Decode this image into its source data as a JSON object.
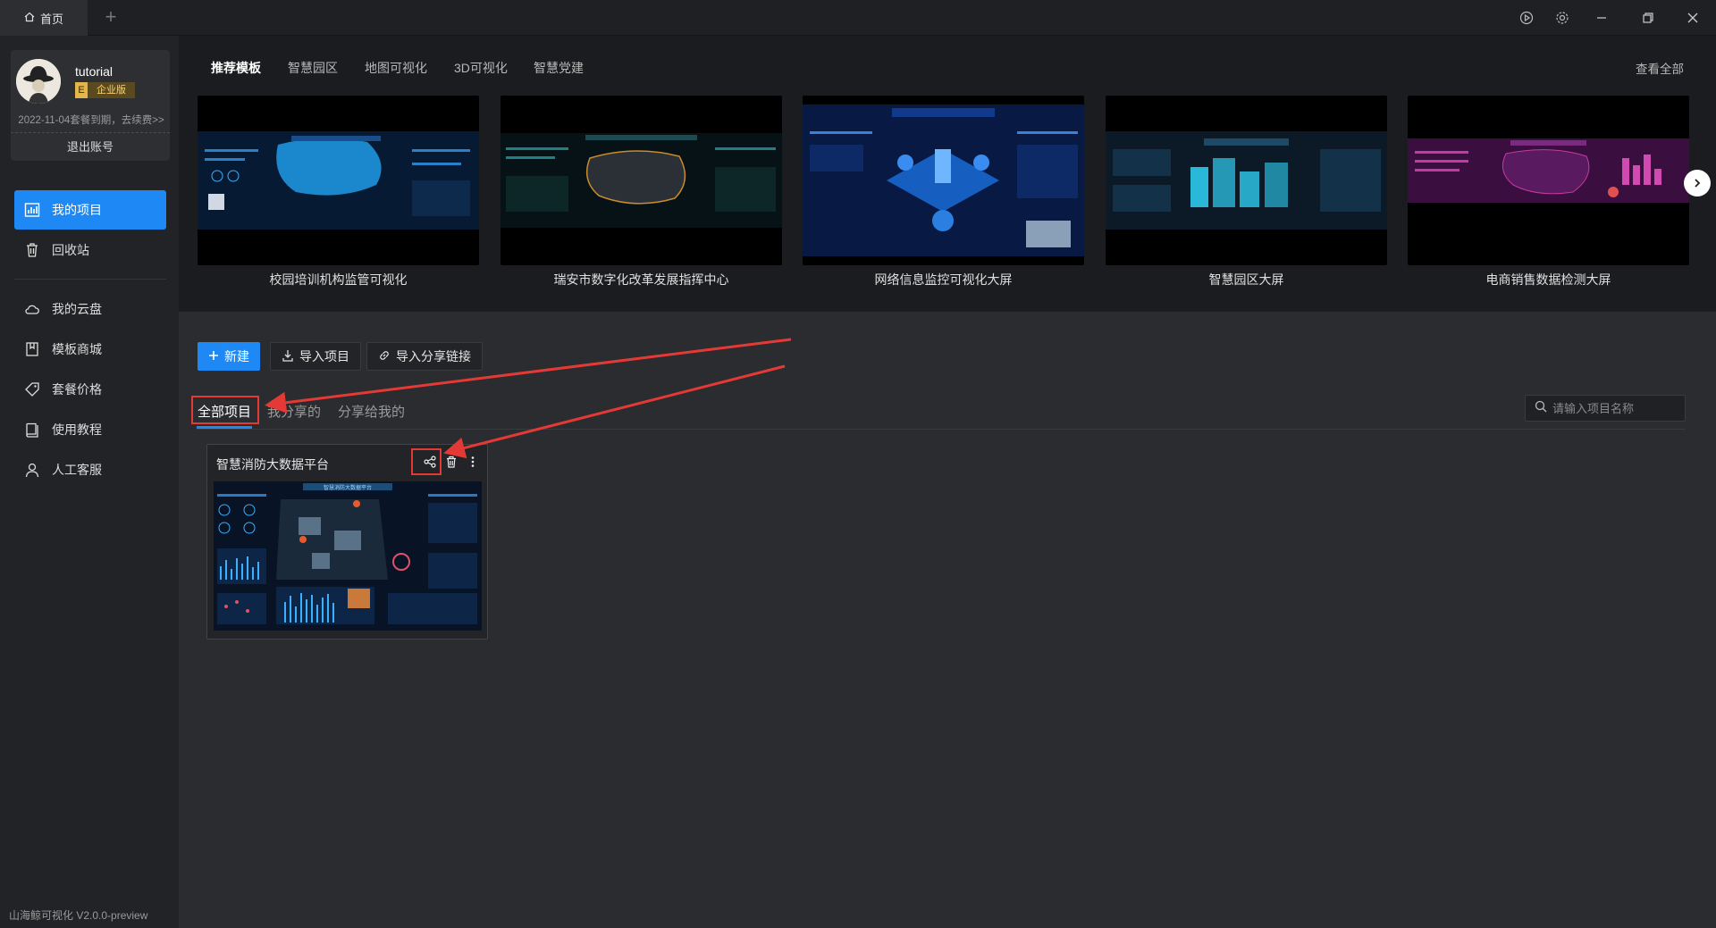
{
  "titlebar": {
    "home_tab_label": "首页",
    "add_tab_symbol": "+"
  },
  "user": {
    "name": "tutorial",
    "badge_letter": "E",
    "badge_text": "企业版",
    "expire_text": "2022-11-04套餐到期，去续费>>",
    "logout_label": "退出账号"
  },
  "sidebar": {
    "items": [
      {
        "label": "我的项目",
        "icon": "chart-icon",
        "active": true
      },
      {
        "label": "回收站",
        "icon": "trash-icon"
      },
      {
        "label": "我的云盘",
        "icon": "cloud-icon"
      },
      {
        "label": "模板商城",
        "icon": "bookmark-icon"
      },
      {
        "label": "套餐价格",
        "icon": "tag-icon"
      },
      {
        "label": "使用教程",
        "icon": "book-icon"
      },
      {
        "label": "人工客服",
        "icon": "user-icon"
      }
    ],
    "version": "山海鲸可视化 V2.0.0-preview"
  },
  "templates": {
    "categories": [
      "推荐模板",
      "智慧园区",
      "地图可视化",
      "3D可视化",
      "智慧党建"
    ],
    "view_all": "查看全部",
    "items": [
      {
        "caption": "校园培训机构监管可视化",
        "accent": "#1e9be8"
      },
      {
        "caption": "瑞安市数字化改革发展指挥中心",
        "accent": "#c98b2b"
      },
      {
        "caption": "网络信息监控可视化大屏",
        "accent": "#1a6fe0"
      },
      {
        "caption": "智慧园区大屏",
        "accent": "#2ab8d8"
      },
      {
        "caption": "电商销售数据检测大屏",
        "accent": "#c43aa0"
      }
    ]
  },
  "toolbar": {
    "new_label": "新建",
    "import_label": "导入项目",
    "import_link_label": "导入分享链接"
  },
  "project_tabs": [
    "全部项目",
    "我分享的",
    "分享给我的"
  ],
  "search": {
    "placeholder": "请输入项目名称"
  },
  "projects": [
    {
      "title": "智慧消防大数据平台",
      "thumb_title": "智慧消防大数据平台"
    }
  ],
  "colors": {
    "accent": "#1e89f5",
    "annotation": "#e53935"
  }
}
